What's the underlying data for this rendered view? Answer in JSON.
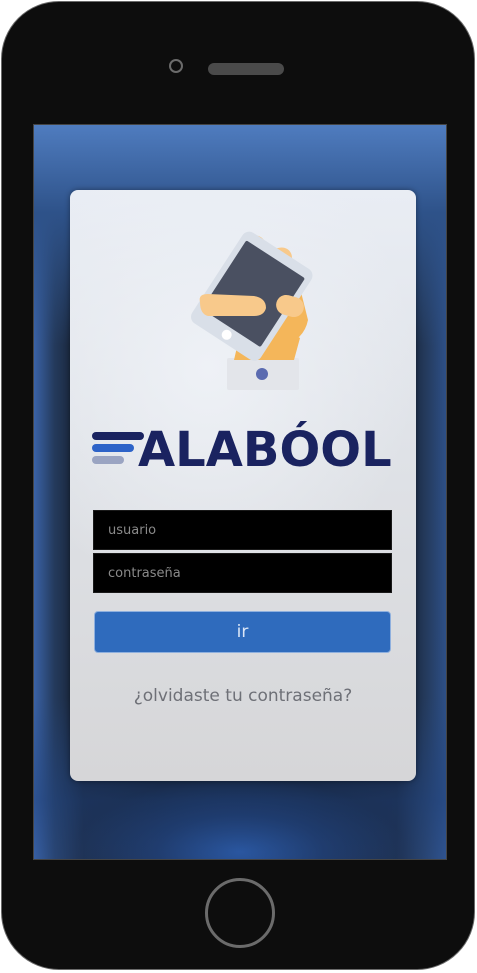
{
  "app": {
    "brand_name": "ALABÓOL",
    "brand_colors": {
      "navy": "#1a2360",
      "blue": "#2d63c8",
      "grey": "#9aa4c2",
      "orange_accent": "#f2a31f"
    },
    "hero_icon": "hand-holding-smartphone-icon"
  },
  "login": {
    "username_placeholder": "usuario",
    "password_placeholder": "contraseña",
    "submit_label": "ir",
    "forgot_password_label": "¿olvidaste tu contraseña?"
  },
  "colors": {
    "button_bg": "#2f6bbd",
    "field_bg": "#000000",
    "link_text": "#6e7077"
  },
  "device": {
    "type": "smartphone-mockup",
    "home_button_icon": "home-button-icon"
  }
}
